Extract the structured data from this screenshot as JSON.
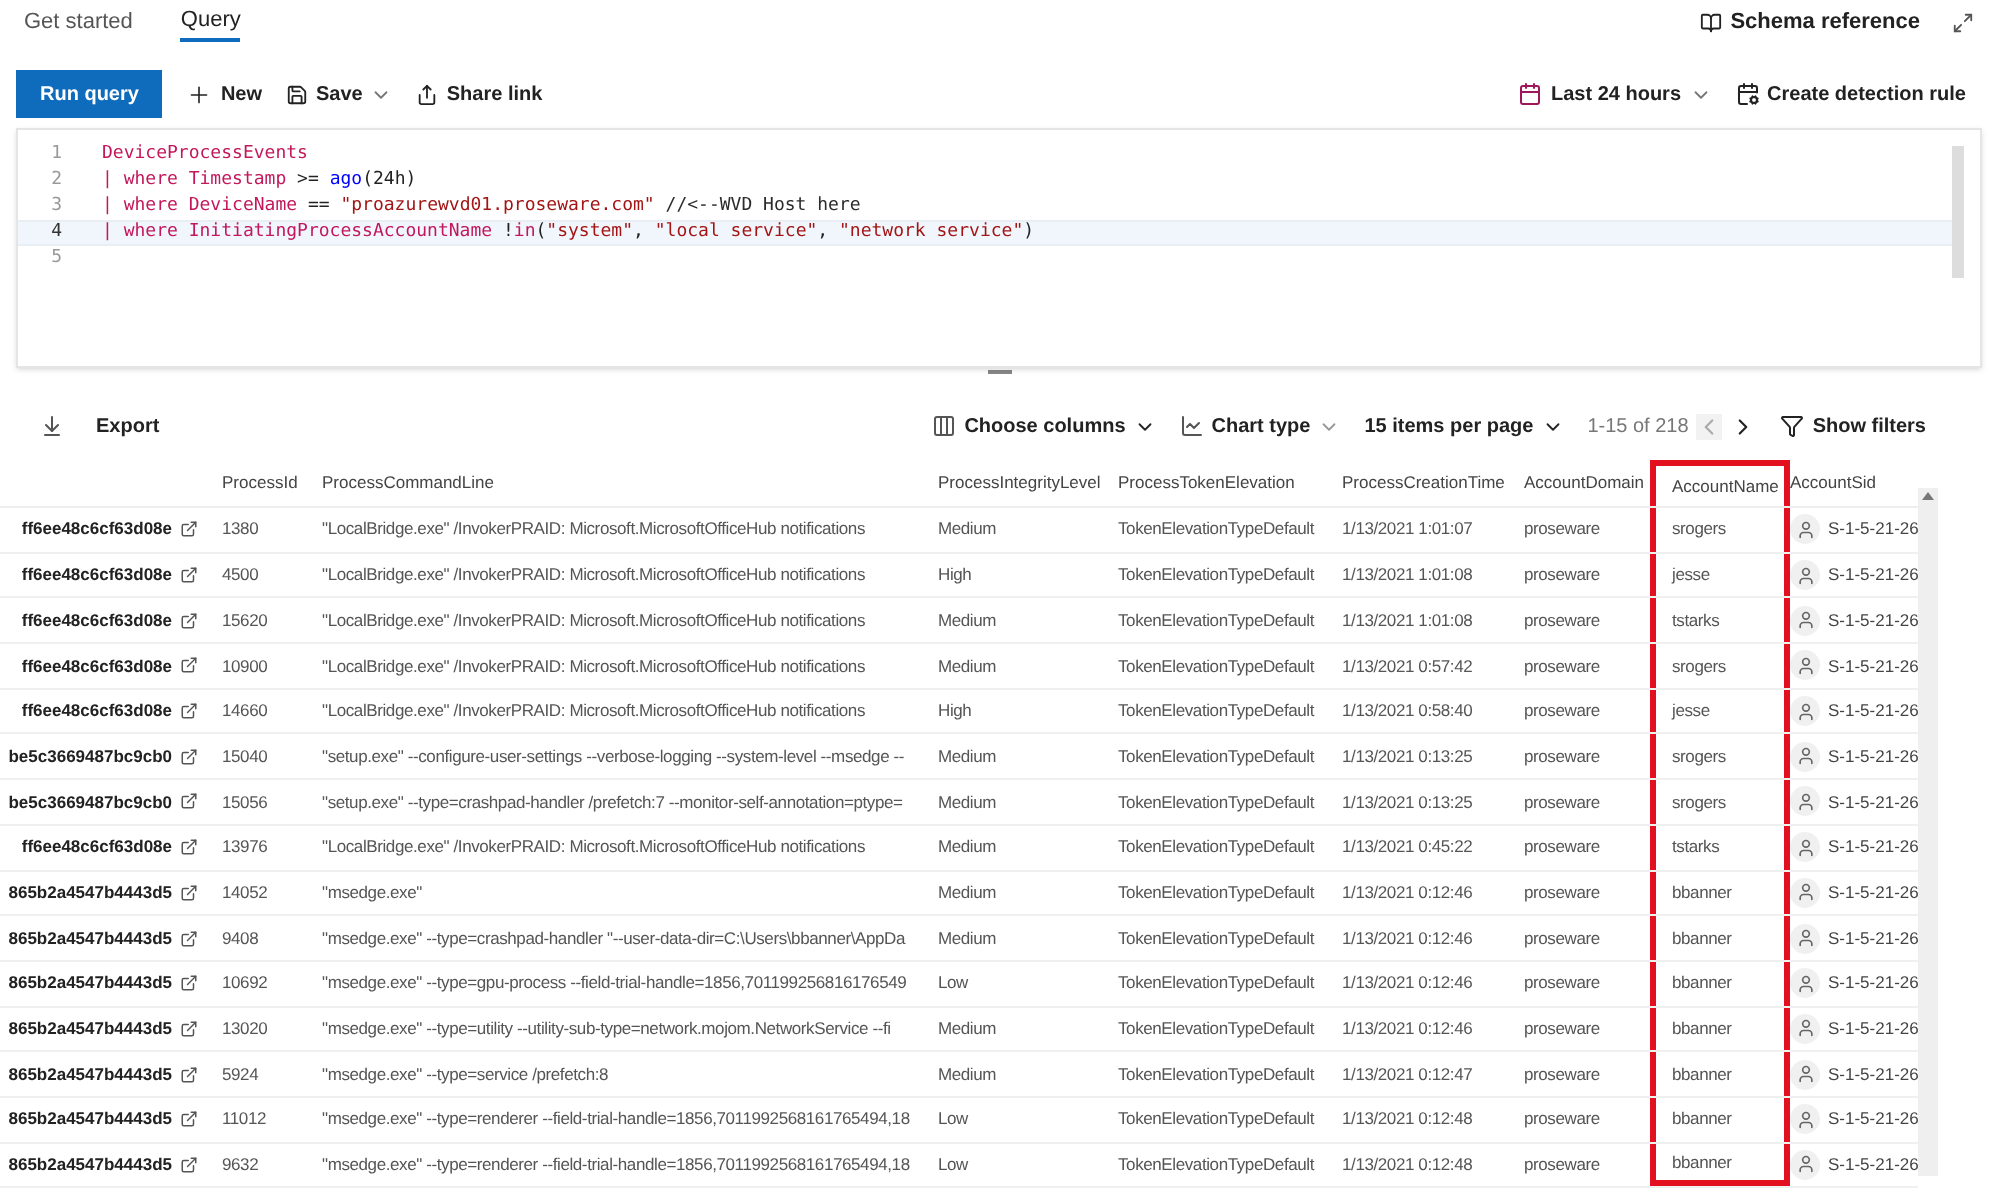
{
  "tabs": [
    {
      "label": "Get started",
      "selected": false
    },
    {
      "label": "Query",
      "selected": true
    }
  ],
  "header_actions": {
    "schema_reference": "Schema reference"
  },
  "toolbar": {
    "run": "Run query",
    "new": "New",
    "save": "Save",
    "share": "Share link",
    "time_range": "Last 24 hours",
    "detection": "Create detection rule"
  },
  "editor": {
    "lines": [
      {
        "number": "1",
        "selected": false,
        "tokens": [
          {
            "kind": "table",
            "text": "DeviceProcessEvents"
          }
        ]
      },
      {
        "number": "2",
        "selected": false,
        "tokens": [
          {
            "kind": "keyword",
            "text": "| where Timestamp "
          },
          {
            "kind": "plain",
            "text": ">= "
          },
          {
            "kind": "func",
            "text": "ago"
          },
          {
            "kind": "plain",
            "text": "(24h)"
          }
        ]
      },
      {
        "number": "3",
        "selected": false,
        "tokens": [
          {
            "kind": "keyword",
            "text": "| where DeviceName "
          },
          {
            "kind": "plain",
            "text": "== "
          },
          {
            "kind": "string",
            "text": "\"proazurewvd01.proseware.com\""
          },
          {
            "kind": "comment",
            "text": " //<--WVD Host here"
          }
        ]
      },
      {
        "number": "4",
        "selected": true,
        "tokens": [
          {
            "kind": "keyword",
            "text": "| where InitiatingProcessAccountName "
          },
          {
            "kind": "plain",
            "text": "!"
          },
          {
            "kind": "keyword",
            "text": "in"
          },
          {
            "kind": "plain",
            "text": "("
          },
          {
            "kind": "string",
            "text": "\"system\""
          },
          {
            "kind": "plain",
            "text": ", "
          },
          {
            "kind": "string",
            "text": "\"local service\""
          },
          {
            "kind": "plain",
            "text": ", "
          },
          {
            "kind": "string",
            "text": "\"network service\""
          },
          {
            "kind": "plain",
            "text": ")"
          }
        ]
      },
      {
        "number": "5",
        "selected": false
      }
    ]
  },
  "results_toolbar": {
    "export": "Export",
    "choose_columns": "Choose columns",
    "chart_type": "Chart type",
    "per_page": "15 items per page",
    "range": "1-15 of 218",
    "show_filters": "Show filters"
  },
  "table": {
    "columns": [
      {
        "highlighted": false
      },
      {
        "label": "ProcessId",
        "highlighted": false
      },
      {
        "label": "ProcessCommandLine",
        "highlighted": false
      },
      {
        "label": "ProcessIntegrityLevel",
        "highlighted": false
      },
      {
        "label": "ProcessTokenElevation",
        "highlighted": false
      },
      {
        "label": "ProcessCreationTime",
        "highlighted": false
      },
      {
        "label": "AccountDomain",
        "highlighted": false
      },
      {
        "label": "AccountName",
        "highlighted": true
      },
      {
        "label": "AccountSid",
        "highlighted": false
      }
    ],
    "rows": [
      [
        "ff6ee48c6cf63d08e",
        "1380",
        "\"LocalBridge.exe\" /InvokerPRAID: Microsoft.MicrosoftOfficeHub notifications",
        "Medium",
        "TokenElevationTypeDefault",
        "1/13/2021 1:01:07",
        "proseware",
        "srogers",
        "S-1-5-21-26"
      ],
      [
        "ff6ee48c6cf63d08e",
        "4500",
        "\"LocalBridge.exe\" /InvokerPRAID: Microsoft.MicrosoftOfficeHub notifications",
        "High",
        "TokenElevationTypeDefault",
        "1/13/2021 1:01:08",
        "proseware",
        "jesse",
        "S-1-5-21-26"
      ],
      [
        "ff6ee48c6cf63d08e",
        "15620",
        "\"LocalBridge.exe\" /InvokerPRAID: Microsoft.MicrosoftOfficeHub notifications",
        "Medium",
        "TokenElevationTypeDefault",
        "1/13/2021 1:01:08",
        "proseware",
        "tstarks",
        "S-1-5-21-26"
      ],
      [
        "ff6ee48c6cf63d08e",
        "10900",
        "\"LocalBridge.exe\" /InvokerPRAID: Microsoft.MicrosoftOfficeHub notifications",
        "Medium",
        "TokenElevationTypeDefault",
        "1/13/2021 0:57:42",
        "proseware",
        "srogers",
        "S-1-5-21-26"
      ],
      [
        "ff6ee48c6cf63d08e",
        "14660",
        "\"LocalBridge.exe\" /InvokerPRAID: Microsoft.MicrosoftOfficeHub notifications",
        "High",
        "TokenElevationTypeDefault",
        "1/13/2021 0:58:40",
        "proseware",
        "jesse",
        "S-1-5-21-26"
      ],
      [
        "be5c3669487bc9cb0",
        "15040",
        "\"setup.exe\" --configure-user-settings --verbose-logging --system-level --msedge --",
        "Medium",
        "TokenElevationTypeDefault",
        "1/13/2021 0:13:25",
        "proseware",
        "srogers",
        "S-1-5-21-26"
      ],
      [
        "be5c3669487bc9cb0",
        "15056",
        "\"setup.exe\" --type=crashpad-handler /prefetch:7 --monitor-self-annotation=ptype=",
        "Medium",
        "TokenElevationTypeDefault",
        "1/13/2021 0:13:25",
        "proseware",
        "srogers",
        "S-1-5-21-26"
      ],
      [
        "ff6ee48c6cf63d08e",
        "13976",
        "\"LocalBridge.exe\" /InvokerPRAID: Microsoft.MicrosoftOfficeHub notifications",
        "Medium",
        "TokenElevationTypeDefault",
        "1/13/2021 0:45:22",
        "proseware",
        "tstarks",
        "S-1-5-21-26"
      ],
      [
        "865b2a4547b4443d5",
        "14052",
        "\"msedge.exe\"",
        "Medium",
        "TokenElevationTypeDefault",
        "1/13/2021 0:12:46",
        "proseware",
        "bbanner",
        "S-1-5-21-26"
      ],
      [
        "865b2a4547b4443d5",
        "9408",
        "\"msedge.exe\" --type=crashpad-handler \"--user-data-dir=C:\\Users\\bbanner\\AppDa",
        "Medium",
        "TokenElevationTypeDefault",
        "1/13/2021 0:12:46",
        "proseware",
        "bbanner",
        "S-1-5-21-26"
      ],
      [
        "865b2a4547b4443d5",
        "10692",
        "\"msedge.exe\" --type=gpu-process --field-trial-handle=1856,701199256816176549",
        "Low",
        "TokenElevationTypeDefault",
        "1/13/2021 0:12:46",
        "proseware",
        "bbanner",
        "S-1-5-21-26"
      ],
      [
        "865b2a4547b4443d5",
        "13020",
        "\"msedge.exe\" --type=utility --utility-sub-type=network.mojom.NetworkService --fi",
        "Medium",
        "TokenElevationTypeDefault",
        "1/13/2021 0:12:46",
        "proseware",
        "bbanner",
        "S-1-5-21-26"
      ],
      [
        "865b2a4547b4443d5",
        "5924",
        "\"msedge.exe\" --type=service /prefetch:8",
        "Medium",
        "TokenElevationTypeDefault",
        "1/13/2021 0:12:47",
        "proseware",
        "bbanner",
        "S-1-5-21-26"
      ],
      [
        "865b2a4547b4443d5",
        "11012",
        "\"msedge.exe\" --type=renderer --field-trial-handle=1856,7011992568161765494,18",
        "Low",
        "TokenElevationTypeDefault",
        "1/13/2021 0:12:48",
        "proseware",
        "bbanner",
        "S-1-5-21-26"
      ],
      [
        "865b2a4547b4443d5",
        "9632",
        "\"msedge.exe\" --type=renderer --field-trial-handle=1856,7011992568161765494,18",
        "Low",
        "TokenElevationTypeDefault",
        "1/13/2021 0:12:48",
        "proseware",
        "bbanner",
        "S-1-5-21-26"
      ]
    ]
  }
}
